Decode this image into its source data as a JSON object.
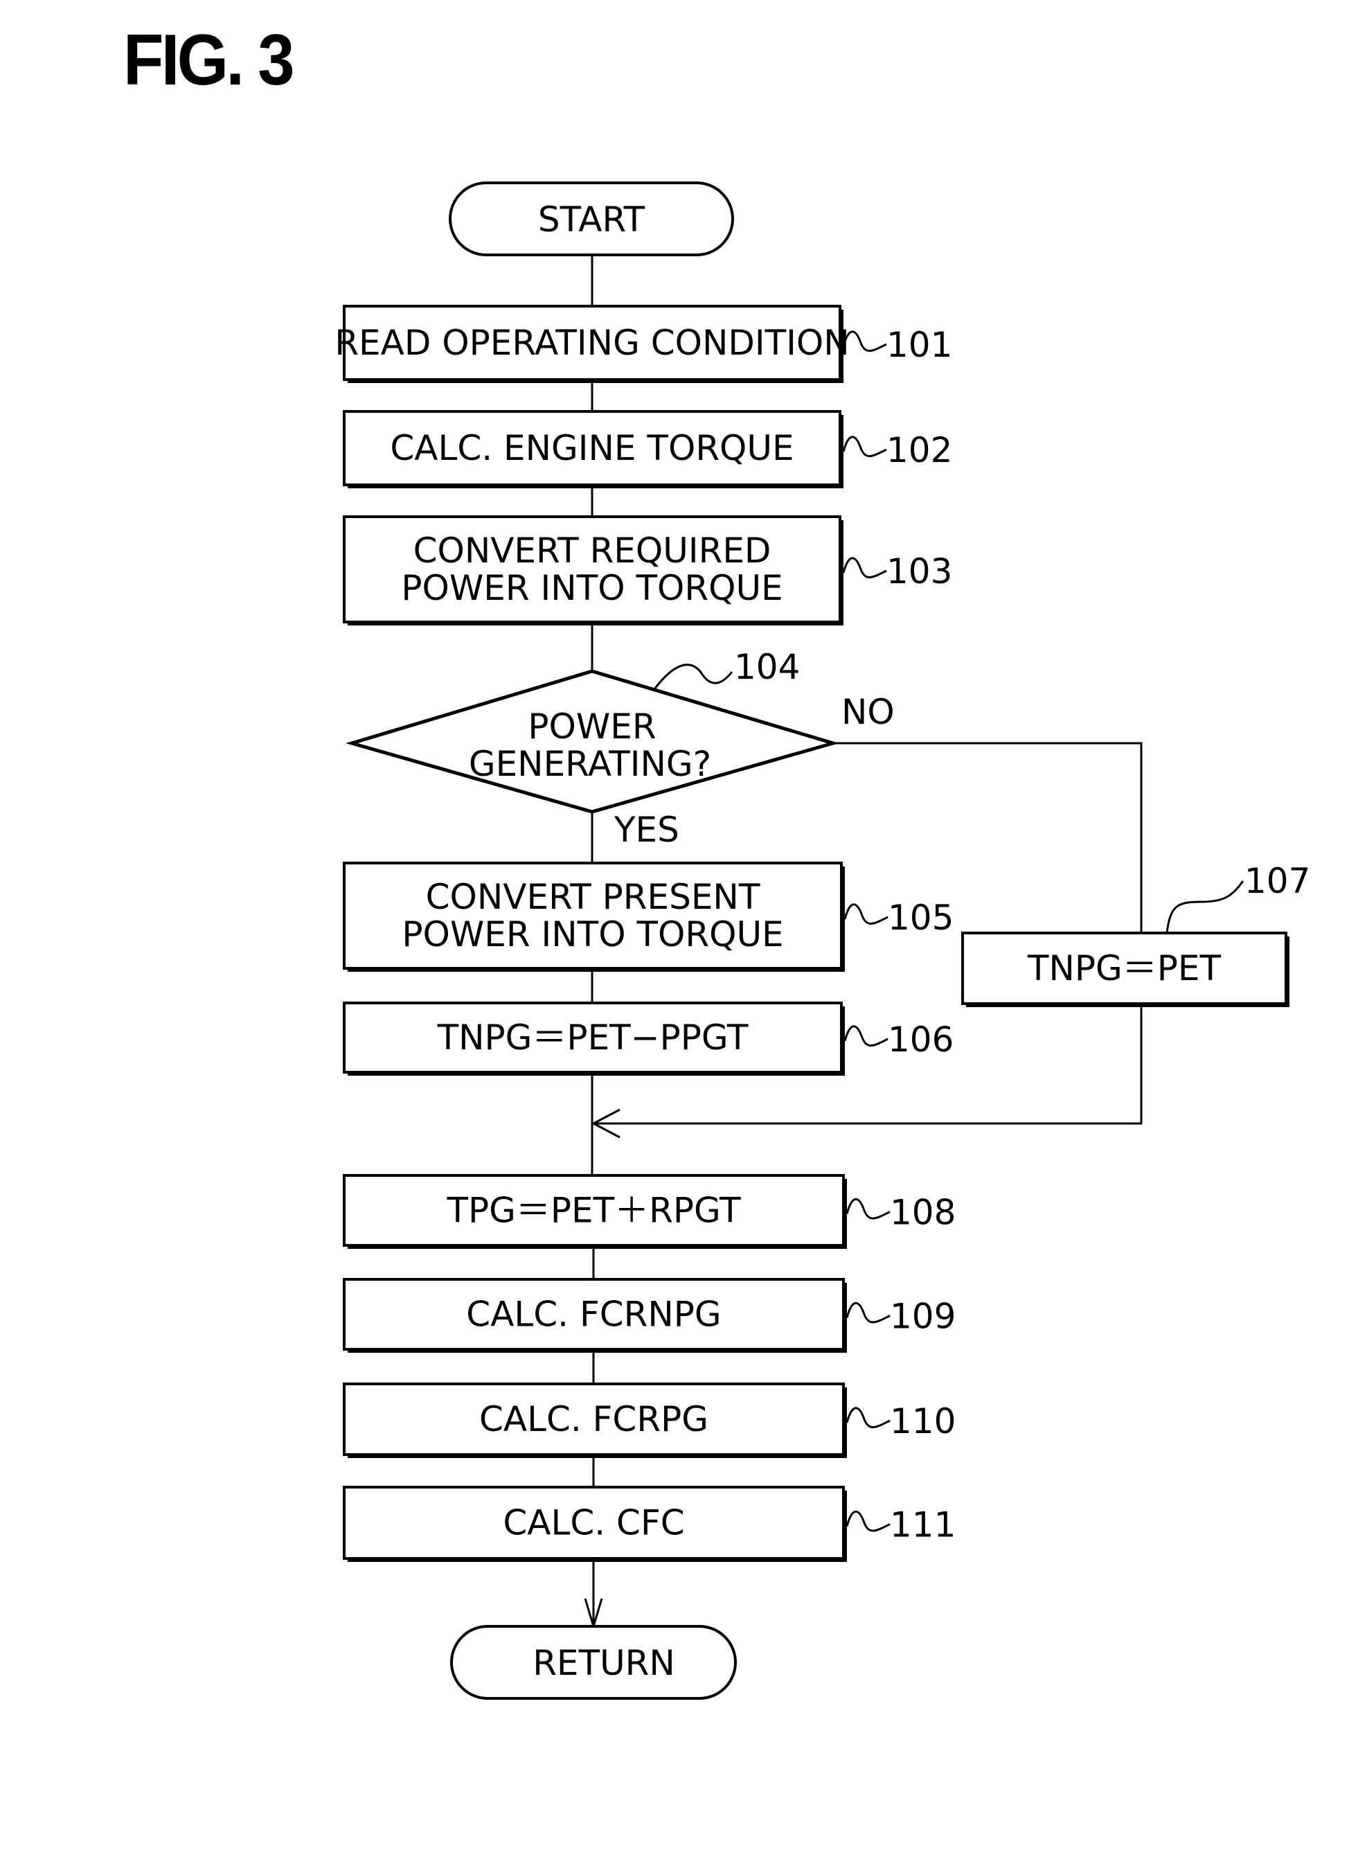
{
  "figure": {
    "title": "FIG. 3"
  },
  "flowchart": {
    "start": "START",
    "end": "RETURN",
    "steps": [
      {
        "ref": "101",
        "lines": [
          "READ OPERATING CONDITION"
        ]
      },
      {
        "ref": "102",
        "lines": [
          "CALC. ENGINE TORQUE"
        ]
      },
      {
        "ref": "103",
        "lines": [
          "CONVERT REQUIRED",
          "POWER INTO TORQUE"
        ]
      },
      {
        "ref": "105",
        "lines": [
          "CONVERT PRESENT",
          "POWER INTO TORQUE"
        ]
      },
      {
        "ref": "106",
        "lines": [
          "TNPG＝PET−PPGT"
        ]
      },
      {
        "ref": "107",
        "lines": [
          "TNPG＝PET"
        ]
      },
      {
        "ref": "108",
        "lines": [
          "TPG＝PET＋RPGT"
        ]
      },
      {
        "ref": "109",
        "lines": [
          "CALC.  FCRNPG"
        ]
      },
      {
        "ref": "110",
        "lines": [
          "CALC.  FCRPG"
        ]
      },
      {
        "ref": "111",
        "lines": [
          "CALC.  CFC"
        ]
      }
    ],
    "decision": {
      "ref": "104",
      "lines": [
        "POWER",
        "GENERATING?"
      ],
      "yes_label": "YES",
      "no_label": "NO"
    }
  }
}
